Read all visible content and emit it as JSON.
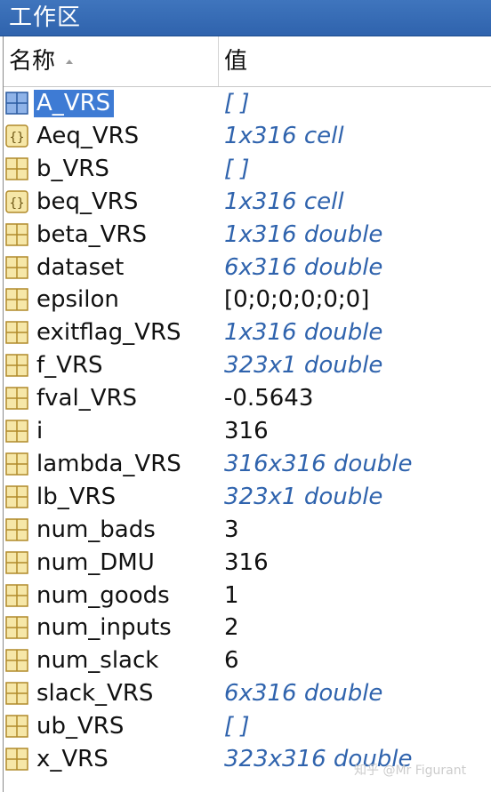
{
  "window": {
    "title": "工作区"
  },
  "columns": {
    "name": "名称",
    "value": "值"
  },
  "variables": [
    {
      "name": "A_VRS",
      "value": "[ ]",
      "style": "meta",
      "icon": "matrix-icon",
      "selected": true
    },
    {
      "name": "Aeq_VRS",
      "value": "1x316 cell",
      "style": "meta",
      "icon": "cell-array-icon"
    },
    {
      "name": "b_VRS",
      "value": "[ ]",
      "style": "meta",
      "icon": "matrix-icon"
    },
    {
      "name": "beq_VRS",
      "value": "1x316 cell",
      "style": "meta",
      "icon": "cell-array-icon"
    },
    {
      "name": "beta_VRS",
      "value": "1x316 double",
      "style": "meta",
      "icon": "matrix-icon"
    },
    {
      "name": "dataset",
      "value": "6x316 double",
      "style": "meta",
      "icon": "matrix-icon"
    },
    {
      "name": "epsilon",
      "value": "[0;0;0;0;0;0]",
      "style": "plain",
      "icon": "matrix-icon"
    },
    {
      "name": "exitflag_VRS",
      "value": "1x316 double",
      "style": "meta",
      "icon": "matrix-icon"
    },
    {
      "name": "f_VRS",
      "value": "323x1 double",
      "style": "meta",
      "icon": "matrix-icon"
    },
    {
      "name": "fval_VRS",
      "value": "-0.5643",
      "style": "plain",
      "icon": "matrix-icon"
    },
    {
      "name": "i",
      "value": "316",
      "style": "plain",
      "icon": "matrix-icon"
    },
    {
      "name": "lambda_VRS",
      "value": "316x316 double",
      "style": "meta",
      "icon": "matrix-icon"
    },
    {
      "name": "lb_VRS",
      "value": "323x1 double",
      "style": "meta",
      "icon": "matrix-icon"
    },
    {
      "name": "num_bads",
      "value": "3",
      "style": "plain",
      "icon": "matrix-icon"
    },
    {
      "name": "num_DMU",
      "value": "316",
      "style": "plain",
      "icon": "matrix-icon"
    },
    {
      "name": "num_goods",
      "value": "1",
      "style": "plain",
      "icon": "matrix-icon"
    },
    {
      "name": "num_inputs",
      "value": "2",
      "style": "plain",
      "icon": "matrix-icon"
    },
    {
      "name": "num_slack",
      "value": "6",
      "style": "plain",
      "icon": "matrix-icon"
    },
    {
      "name": "slack_VRS",
      "value": "6x316 double",
      "style": "meta",
      "icon": "matrix-icon"
    },
    {
      "name": "ub_VRS",
      "value": "[ ]",
      "style": "meta",
      "icon": "matrix-icon"
    },
    {
      "name": "x_VRS",
      "value": "323x316 double",
      "style": "meta",
      "icon": "matrix-icon"
    }
  ],
  "watermark": "知乎 @Mr Figurant",
  "colors": {
    "titlebar": "#2f63ad",
    "selection": "#3e7bd4",
    "meta_text": "#2f63ad",
    "icon_fill": "#f6e7a8",
    "icon_grid": "#b08a2a"
  }
}
